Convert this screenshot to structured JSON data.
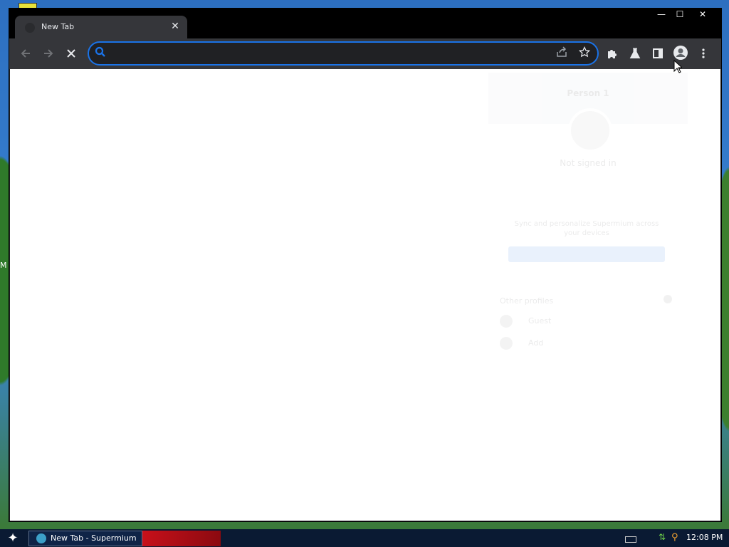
{
  "browser": {
    "tab": {
      "title": "New Tab",
      "close_glyph": "✕"
    },
    "omnibox": {
      "value": "",
      "placeholder": ""
    }
  },
  "window_controls": {
    "minimize": "—",
    "maximize": "☐",
    "close": "✕"
  },
  "profile_popup": {
    "name": "Person 1",
    "status": "Not signed in",
    "sync_text": "Sync and personalize Supermium across your devices",
    "other_profiles_label": "Other profiles",
    "guest_label": "Guest",
    "add_label": "Add"
  },
  "taskbar": {
    "task_label": "New Tab - Supermium",
    "clock": "12:08 PM"
  },
  "desktop": {
    "edge_letter": "M"
  },
  "colors": {
    "accent": "#1a73e8",
    "toolbar": "#35363a",
    "titlebar": "#000000"
  }
}
